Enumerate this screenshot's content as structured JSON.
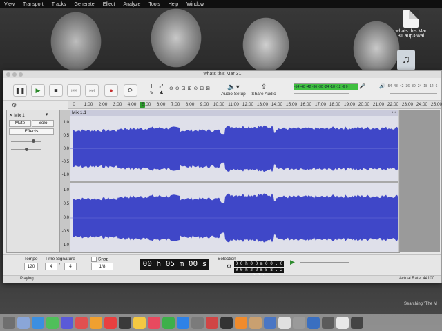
{
  "menubar": {
    "items": [
      "View",
      "Transport",
      "Tracks",
      "Generate",
      "Effect",
      "Analyze",
      "Tools",
      "Help",
      "Window"
    ]
  },
  "desktop": {
    "file_label_line1": "whats this Mar",
    "file_label_line2": "31.aup3-wal",
    "searching_text": "Searching \"The M"
  },
  "window": {
    "title": "whats this Mar 31"
  },
  "toolbar": {
    "pause": "pause-icon",
    "play": "play-icon",
    "stop": "stop-icon",
    "skip_start": "skip-start-icon",
    "skip_end": "skip-end-icon",
    "record": "record-icon",
    "loop": "loop-icon",
    "audio_setup_label": "Audio Setup",
    "share_audio_label": "Share Audio",
    "meter_ticks": "-54 -48 -42 -36 -30 -24 -18 -12 -6 0",
    "play_meter_ticks": "-54 -48 -42 -36 -30 -24 -18 -12 -6 0",
    "meter_level": 1.0
  },
  "ruler": {
    "ticks": [
      "0",
      "1:00",
      "2:00",
      "3:00",
      "4:00",
      "5:00",
      "6:00",
      "7:00",
      "8:00",
      "9:00",
      "10:00",
      "11:00",
      "12:00",
      "13:00",
      "14:00",
      "15:00",
      "16:00",
      "17:00",
      "18:00",
      "19:00",
      "20:00",
      "21:00",
      "22:00",
      "23:00",
      "24:00",
      "25:00"
    ]
  },
  "track": {
    "name": "Mix 1",
    "mute": "Mute",
    "solo": "Solo",
    "effects": "Effects",
    "clip_name": "Mix 1.1",
    "scale_top": [
      "1.0",
      "0.5",
      "0.0",
      "-0.5",
      "-1.0"
    ],
    "scale_bottom": [
      "1.0",
      "0.5",
      "0.0",
      "-0.5",
      "-1.0"
    ]
  },
  "bottom": {
    "tempo_label": "Tempo",
    "tempo_value": "120",
    "timesig_label": "Time Signature",
    "timesig_num": "4",
    "timesig_slash": "/",
    "timesig_den": "4",
    "snap_label": "Snap",
    "snap_value": "1/8",
    "time_display": "00 h 05 m 00 s",
    "selection_label": "Selection",
    "sel_start": "0 0 h 0 0 m 0 0 . 0 0 0 s",
    "sel_end": "0 0 h 2 2 m 5 8 . 2 9 7 s"
  },
  "status": {
    "left": "Playing.",
    "right": "Actual Rate: 44100"
  },
  "colors": {
    "waveform": "#3f47c8",
    "clip_bg": "#dfe0ea",
    "meter_green": "#3fbf3f"
  }
}
